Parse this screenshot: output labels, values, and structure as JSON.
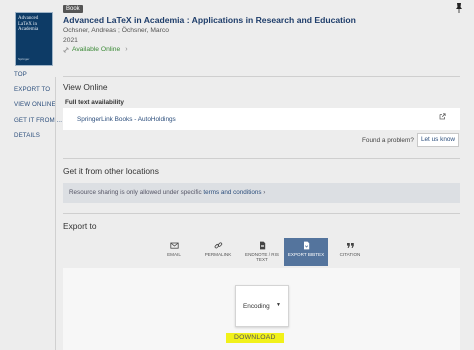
{
  "cover": {
    "title": "Advanced LaTeX in Academia",
    "subtitle": "Applications in Research and Education",
    "publisher": "Springer"
  },
  "record": {
    "type_badge": "Book",
    "title": "Advanced LaTeX in Academia : Applications in Research and Education",
    "authors": "Ochsner, Andreas ; Öchsner, Marco",
    "year": "2021",
    "availability": "Available Online"
  },
  "nav": {
    "items": [
      "TOP",
      "EXPORT TO",
      "VIEW ONLINE",
      "GET IT FROM ...",
      "DETAILS"
    ]
  },
  "view_online": {
    "heading": "View Online",
    "fulltext_label": "Full text availability",
    "link": "SpringerLink Books - AutoHoldings",
    "found_problem": "Found a problem?",
    "let_us_know": "Let us know"
  },
  "get_it": {
    "heading": "Get it from other locations",
    "notice_prefix": "Resource sharing is only allowed under specific",
    "notice_link": "terms and conditions"
  },
  "export": {
    "heading": "Export to",
    "tabs": [
      {
        "label": "EMAIL",
        "icon": "email-icon"
      },
      {
        "label": "PERMALINK",
        "icon": "link-icon"
      },
      {
        "label": "ENDNOTE / RIS TEXT",
        "icon": "document-icon"
      },
      {
        "label": "EXPORT BIBTEX",
        "icon": "file-icon"
      },
      {
        "label": "CITATION",
        "icon": "quote-icon"
      }
    ],
    "active_tab": "EXPORT BIBTEX",
    "encoding_label": "Encoding",
    "download_label": "DOWNLOAD"
  },
  "colors": {
    "accent": "#54749d",
    "link": "#2c4e7c",
    "available": "#3b8a37",
    "highlight": "#f1f11a"
  }
}
